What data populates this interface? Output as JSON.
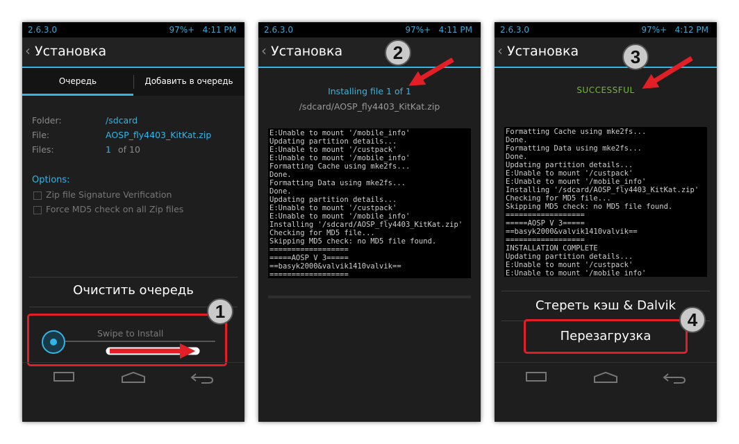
{
  "status": {
    "version": "2.6.3.0",
    "battery1": "97%+",
    "time1": "4:11 PM",
    "battery2": "97%+",
    "time2": "4:11 PM",
    "battery3": "97%+",
    "time3": "4:12 PM"
  },
  "screen1": {
    "title": "Установка",
    "tabs": [
      "Очередь",
      "Добавить в очередь"
    ],
    "folder_label": "Folder:",
    "folder_value": "/sdcard",
    "file_label": "File:",
    "file_value": "AOSP_fly4403_KitKat.zip",
    "files_label": "Files:",
    "files_count": "1",
    "files_total": "of 10",
    "options_label": "Options:",
    "option1": "Zip file Signature Verification",
    "option2": "Force MD5 check on all Zip files",
    "clear_queue": "Очистить очередь",
    "swipe_label": "Swipe to Install"
  },
  "screen2": {
    "title": "Установка",
    "installing": "Installing file 1 of 1",
    "file_path": "/sdcard/AOSP_fly4403_KitKat.zip",
    "log": [
      "E:Unable to mount '/mobile_info'",
      "Updating partition details...",
      "E:Unable to mount '/custpack'",
      "E:Unable to mount '/mobile_info'",
      "Formatting Cache using mke2fs...",
      "Done.",
      "Formatting Data using mke2fs...",
      "Done.",
      "Updating partition details...",
      "E:Unable to mount '/custpack'",
      "E:Unable to mount '/mobile_info'",
      "Installing '/sdcard/AOSP_fly4403_KitKat.zip'",
      "Checking for MD5 file...",
      "Skipping MD5 check: no MD5 file found.",
      "==================",
      "=====AOSP V 3=====",
      "==basyk2000&valvik1410valvik==",
      "=================="
    ]
  },
  "screen3": {
    "title": "Установка",
    "result": "SUCCESSFUL",
    "log": [
      "Formatting Cache using mke2fs...",
      "Done.",
      "Formatting Data using mke2fs...",
      "Done.",
      "Updating partition details...",
      "E:Unable to mount '/custpack'",
      "E:Unable to mount '/mobile_info'",
      "Installing '/sdcard/AOSP_fly4403_KitKat.zip'",
      "Checking for MD5 file...",
      "Skipping MD5 check: no MD5 file found.",
      "==================",
      "=====AOSP V 3=====",
      "==basyk2000&valvik1410valvik==",
      "==================",
      "INSTALLATION COMPLETE",
      "Updating partition details...",
      "E:Unable to mount '/custpack'",
      "E:Unable to mount '/mobile_info'"
    ],
    "wipe_cache": "Стереть кэш & Dalvik",
    "reboot": "Перезагрузка"
  },
  "badges": [
    "1",
    "2",
    "3",
    "4"
  ],
  "colors": {
    "accent": "#33b5e5",
    "success": "#6fbf2a",
    "highlight": "#e21f26"
  }
}
